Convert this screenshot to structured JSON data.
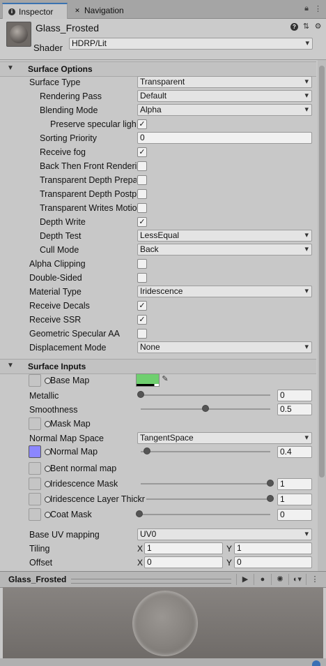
{
  "tabs": [
    {
      "label": "Inspector",
      "icon": "info-icon"
    },
    {
      "label": "Navigation",
      "icon": "navigation-icon"
    }
  ],
  "material": {
    "name": "Glass_Frosted",
    "shader_label": "Shader",
    "shader_value": "HDRP/Lit"
  },
  "surface_options": {
    "title": "Surface Options",
    "surface_type": {
      "label": "Surface Type",
      "value": "Transparent"
    },
    "rendering_pass": {
      "label": "Rendering Pass",
      "value": "Default"
    },
    "blending_mode": {
      "label": "Blending Mode",
      "value": "Alpha"
    },
    "preserve_specular": {
      "label": "Preserve specular ligh",
      "checked": true
    },
    "sorting_priority": {
      "label": "Sorting Priority",
      "value": "0"
    },
    "receive_fog": {
      "label": "Receive fog",
      "checked": true
    },
    "back_then_front": {
      "label": "Back Then Front Renderi",
      "checked": false
    },
    "transparent_depth_prepass": {
      "label": "Transparent Depth Prepa",
      "checked": false
    },
    "transparent_depth_postpass": {
      "label": "Transparent Depth Postp",
      "checked": false
    },
    "transparent_writes_motion": {
      "label": "Transparent Writes Motio",
      "checked": false
    },
    "depth_write": {
      "label": "Depth Write",
      "checked": true
    },
    "depth_test": {
      "label": "Depth Test",
      "value": "LessEqual"
    },
    "cull_mode": {
      "label": "Cull Mode",
      "value": "Back"
    },
    "alpha_clipping": {
      "label": "Alpha Clipping",
      "checked": false
    },
    "double_sided": {
      "label": "Double-Sided",
      "checked": false
    },
    "material_type": {
      "label": "Material Type",
      "value": "Iridescence"
    },
    "receive_decals": {
      "label": "Receive Decals",
      "checked": true
    },
    "receive_ssr": {
      "label": "Receive SSR",
      "checked": true
    },
    "geometric_specular_aa": {
      "label": "Geometric Specular AA",
      "checked": false
    },
    "displacement_mode": {
      "label": "Displacement Mode",
      "value": "None"
    }
  },
  "surface_inputs": {
    "title": "Surface Inputs",
    "base_map": {
      "label": "Base Map",
      "color": "#6fcf6f"
    },
    "metallic": {
      "label": "Metallic",
      "value": "0",
      "fraction": 0.0
    },
    "smoothness": {
      "label": "Smoothness",
      "value": "0.5",
      "fraction": 0.5
    },
    "mask_map": {
      "label": "Mask Map"
    },
    "normal_map_space": {
      "label": "Normal Map Space",
      "value": "TangentSpace"
    },
    "normal_map": {
      "label": "Normal Map",
      "value": "0.4",
      "fraction": 0.05
    },
    "bent_normal_map": {
      "label": "Bent normal map"
    },
    "iridescence_mask": {
      "label": "Iridescence Mask",
      "value": "1",
      "fraction": 1.0
    },
    "iridescence_layer_thickness": {
      "label": "Iridescence Layer Thickr",
      "value": "1",
      "fraction": 1.0
    },
    "coat_mask": {
      "label": "Coat Mask",
      "value": "0",
      "fraction": 0.0
    },
    "base_uv_mapping": {
      "label": "Base UV mapping",
      "value": "UV0"
    },
    "tiling": {
      "label": "Tiling",
      "x_label": "X",
      "x": "1",
      "y_label": "Y",
      "y": "1"
    },
    "offset": {
      "label": "Offset",
      "x_label": "X",
      "x": "0",
      "y_label": "Y",
      "y": "0"
    }
  },
  "preview": {
    "name": "Glass_Frosted"
  },
  "checkmark": "✓"
}
